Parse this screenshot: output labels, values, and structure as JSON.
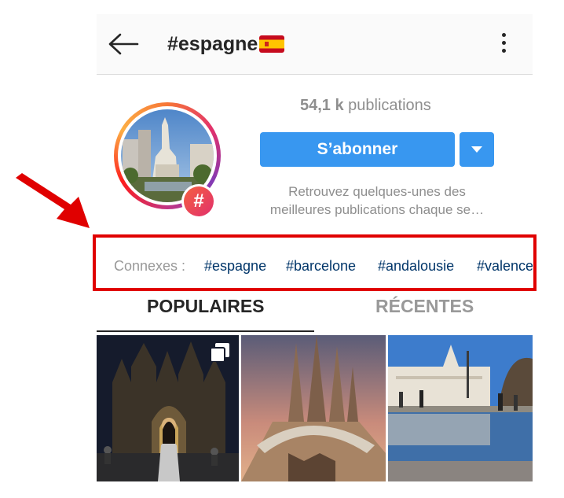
{
  "header": {
    "title": "#espagne",
    "flag": "spain-flag"
  },
  "profile": {
    "count_value": "54,1 k",
    "count_label": "publications",
    "follow_label": "S’abonner",
    "description_line1": "Retrouvez quelques-unes des",
    "description_line2": "meilleures publications chaque se…",
    "badge_symbol": "#"
  },
  "related": {
    "label": "Connexes :",
    "tags": [
      "#espagne",
      "#barcelone",
      "#andalousie",
      "#valence"
    ]
  },
  "tabs": {
    "popular": "POPULAIRES",
    "recent": "RÉCENTES"
  },
  "colors": {
    "accent": "#3897f0",
    "highlight": "#e00000",
    "tag": "#003569"
  }
}
